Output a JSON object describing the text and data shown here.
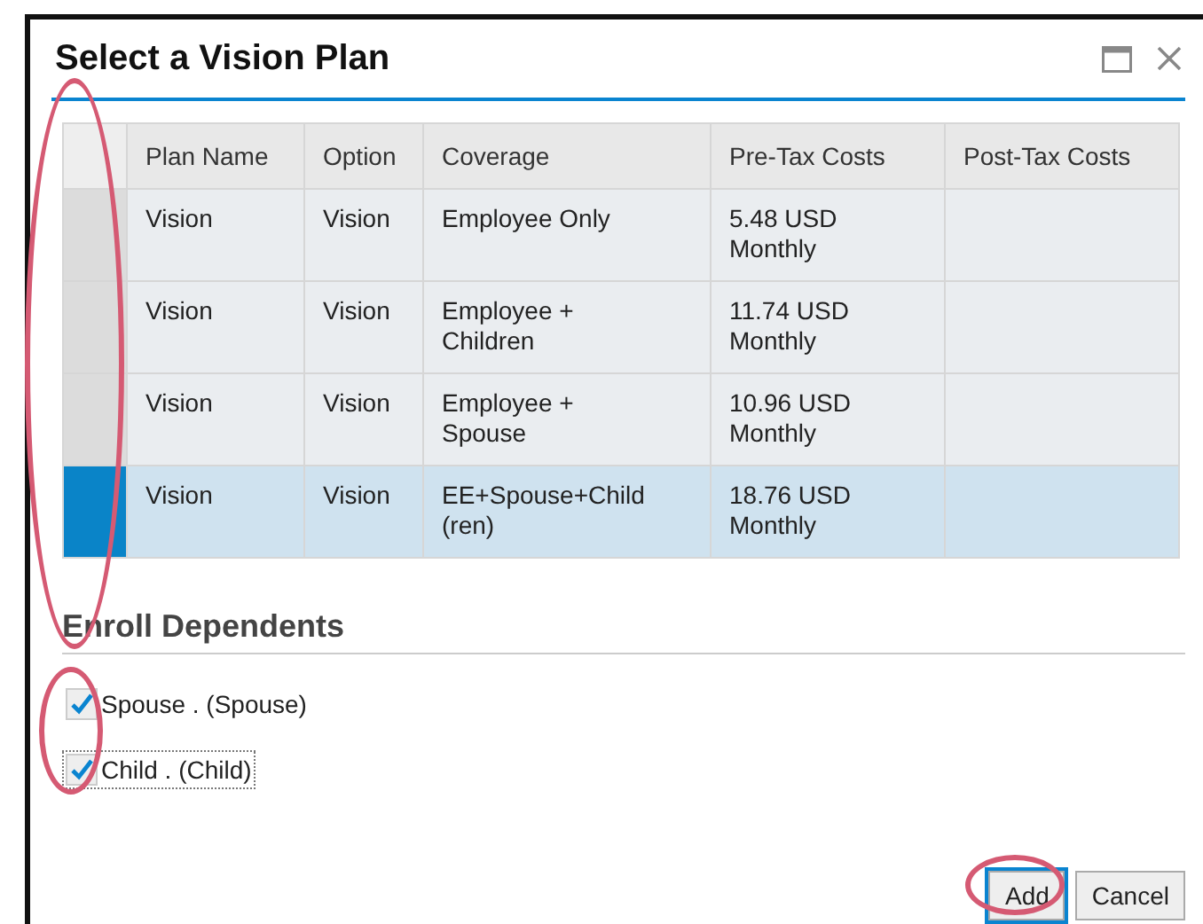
{
  "dialog": {
    "title": "Select a Vision Plan",
    "window_controls": [
      {
        "kind": "maximize"
      },
      {
        "kind": "close"
      }
    ]
  },
  "table": {
    "columns": [
      "Plan Name",
      "Option",
      "Coverage",
      "Pre-Tax Costs",
      "Post-Tax Costs"
    ],
    "rows": [
      {
        "selected": false,
        "cells": [
          "Vision",
          "Vision",
          "Employee Only",
          "5.48 USD Monthly",
          ""
        ]
      },
      {
        "selected": false,
        "cells": [
          "Vision",
          "Vision",
          "Employee + Children",
          "11.74 USD Monthly",
          ""
        ]
      },
      {
        "selected": false,
        "cells": [
          "Vision",
          "Vision",
          "Employee + Spouse",
          "10.96 USD Monthly",
          ""
        ]
      },
      {
        "selected": true,
        "cells": [
          "Vision",
          "Vision",
          "EE+Spouse+Child (ren)",
          "18.76 USD Monthly",
          ""
        ]
      }
    ]
  },
  "dependents": {
    "heading": "Enroll Dependents",
    "items": [
      {
        "label": "Spouse . (Spouse)",
        "checked": true,
        "focused": false
      },
      {
        "label": "Child . (Child)",
        "checked": true,
        "focused": true
      }
    ]
  },
  "buttons": [
    {
      "label": "Add",
      "focused": true
    },
    {
      "label": "Cancel",
      "focused": false
    }
  ],
  "annotation_marks": [
    {
      "kind": "selector-column"
    },
    {
      "kind": "checkboxes"
    },
    {
      "kind": "add-button"
    }
  ]
}
